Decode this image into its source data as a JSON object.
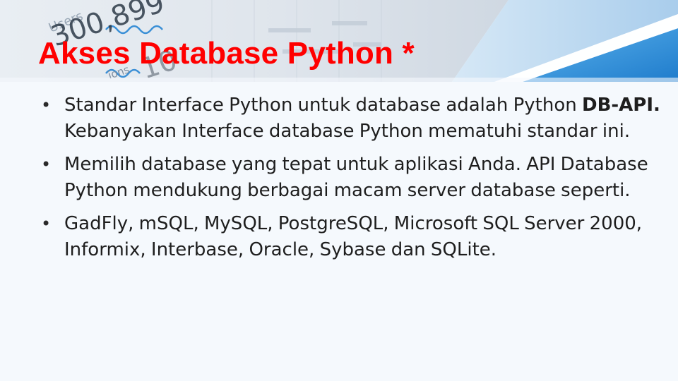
{
  "slide": {
    "title": "Akses Database Python *",
    "bullet_glyph": "•",
    "header_image": {
      "icon": "analytics-chart-photo",
      "texts": {
        "users": "Users",
        "big_number": "300,899",
        "side_label": "ions",
        "small_number": "10"
      }
    },
    "bullets": [
      {
        "text_before": "Standar Interface Python untuk database adalah Python ",
        "bold": "DB-API.",
        "text_after": " Kebanyakan Interface database Python mematuhi standar ini."
      },
      {
        "text": "Memilih database yang tepat untuk aplikasi Anda. API Database Python mendukung berbagai macam server database seperti."
      },
      {
        "text": "GadFly, mSQL, MySQL, PostgreSQL, Microsoft SQL Server 2000, Informix, Interbase, Oracle, Sybase dan SQLite."
      }
    ],
    "colors": {
      "title": "#ff0000",
      "accent_blue": "#2f8fd8",
      "text": "#1e1e1e"
    }
  }
}
